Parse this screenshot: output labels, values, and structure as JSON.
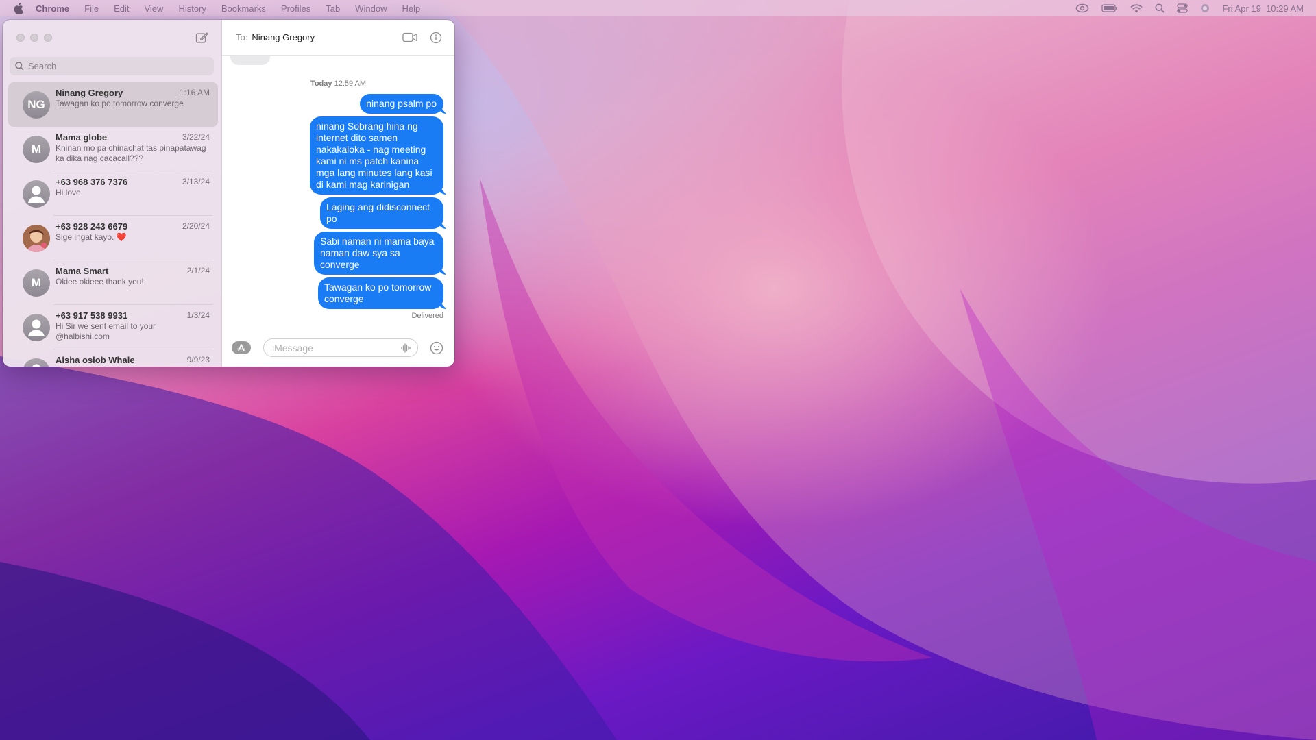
{
  "menubar": {
    "app_name": "Chrome",
    "items": [
      "File",
      "Edit",
      "View",
      "History",
      "Bookmarks",
      "Profiles",
      "Tab",
      "Window",
      "Help"
    ],
    "datetime": "Fri Apr 19  10:29 AM"
  },
  "sidebar": {
    "search_placeholder": "Search",
    "conversations": [
      {
        "initials": "NG",
        "name": "Ninang Gregory",
        "date": "1:16 AM",
        "preview": "Tawagan ko po tomorrow converge",
        "avatar": "initials",
        "selected": true
      },
      {
        "initials": "M",
        "name": "Mama globe",
        "date": "3/22/24",
        "preview": "Kninan mo pa chinachat tas pinapatawag ka dika nag cacacall???",
        "avatar": "initials"
      },
      {
        "initials": "",
        "name": "+63 968 376 7376",
        "date": "3/13/24",
        "preview": "Hi love",
        "avatar": "person-icon"
      },
      {
        "initials": "",
        "name": "+63 928 243 6679",
        "date": "2/20/24",
        "preview": "Sige ingat kayo. ❤️",
        "avatar": "photo"
      },
      {
        "initials": "M",
        "name": "Mama Smart",
        "date": "2/1/24",
        "preview": "Okiee okieee thank you!",
        "avatar": "initials"
      },
      {
        "initials": "",
        "name": "+63 917 538 9931",
        "date": "1/3/24",
        "preview": "Hi Sir we sent email to your @halbishi.com",
        "avatar": "person-icon"
      },
      {
        "initials": "",
        "name": "Aisha oslob Whale",
        "date": "9/9/23",
        "preview": "",
        "avatar": "person-icon"
      }
    ]
  },
  "chat": {
    "to_label": "To:",
    "recipient": "Ninang Gregory",
    "timestamp_day": "Today",
    "timestamp_time": "12:59 AM",
    "messages": [
      "ninang psalm po",
      "ninang Sobrang hina ng internet dito samen nakakaloka - nag meeting kami ni ms patch kanina mga lang minutes lang kasi di kami mag karinigan",
      "Laging ang didisconnect po",
      "Sabi naman ni mama baya naman daw sya sa converge",
      "Tawagan ko po tomorrow converge"
    ],
    "status": "Delivered",
    "input_placeholder": "iMessage"
  },
  "colors": {
    "bubble": "#1a7cf5",
    "accent": "#1a7cf5"
  }
}
